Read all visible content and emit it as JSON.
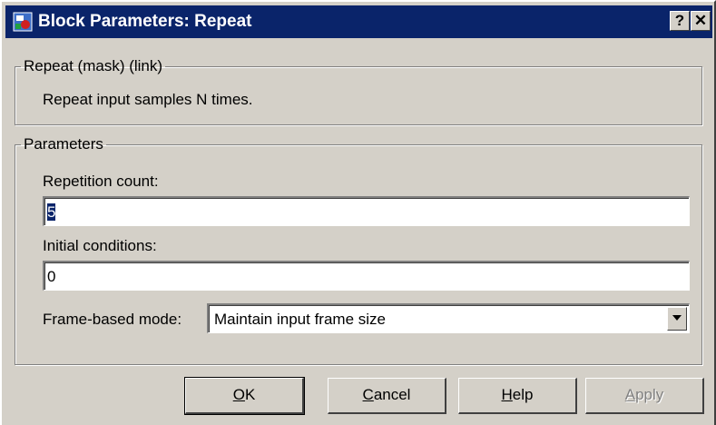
{
  "window": {
    "title": "Block Parameters: Repeat",
    "help_glyph": "?",
    "close_glyph": "✕"
  },
  "description_group": {
    "legend": "Repeat (mask) (link)",
    "text": "Repeat input samples N times."
  },
  "parameters_group": {
    "legend": "Parameters",
    "repetition_count": {
      "label": "Repetition count:",
      "value": "5"
    },
    "initial_conditions": {
      "label": "Initial conditions:",
      "value": "0"
    },
    "frame_based_mode": {
      "label": "Frame-based mode:",
      "selected": "Maintain input frame size"
    }
  },
  "buttons": {
    "ok": {
      "accel": "O",
      "rest": "K"
    },
    "cancel": {
      "accel": "C",
      "rest": "ancel"
    },
    "help": {
      "accel": "H",
      "rest": "elp"
    },
    "apply": {
      "accel": "A",
      "rest": "pply",
      "enabled": false
    }
  },
  "colors": {
    "titlebar": "#0a246a",
    "face": "#d4d0c8",
    "selection": "#0a246a"
  }
}
